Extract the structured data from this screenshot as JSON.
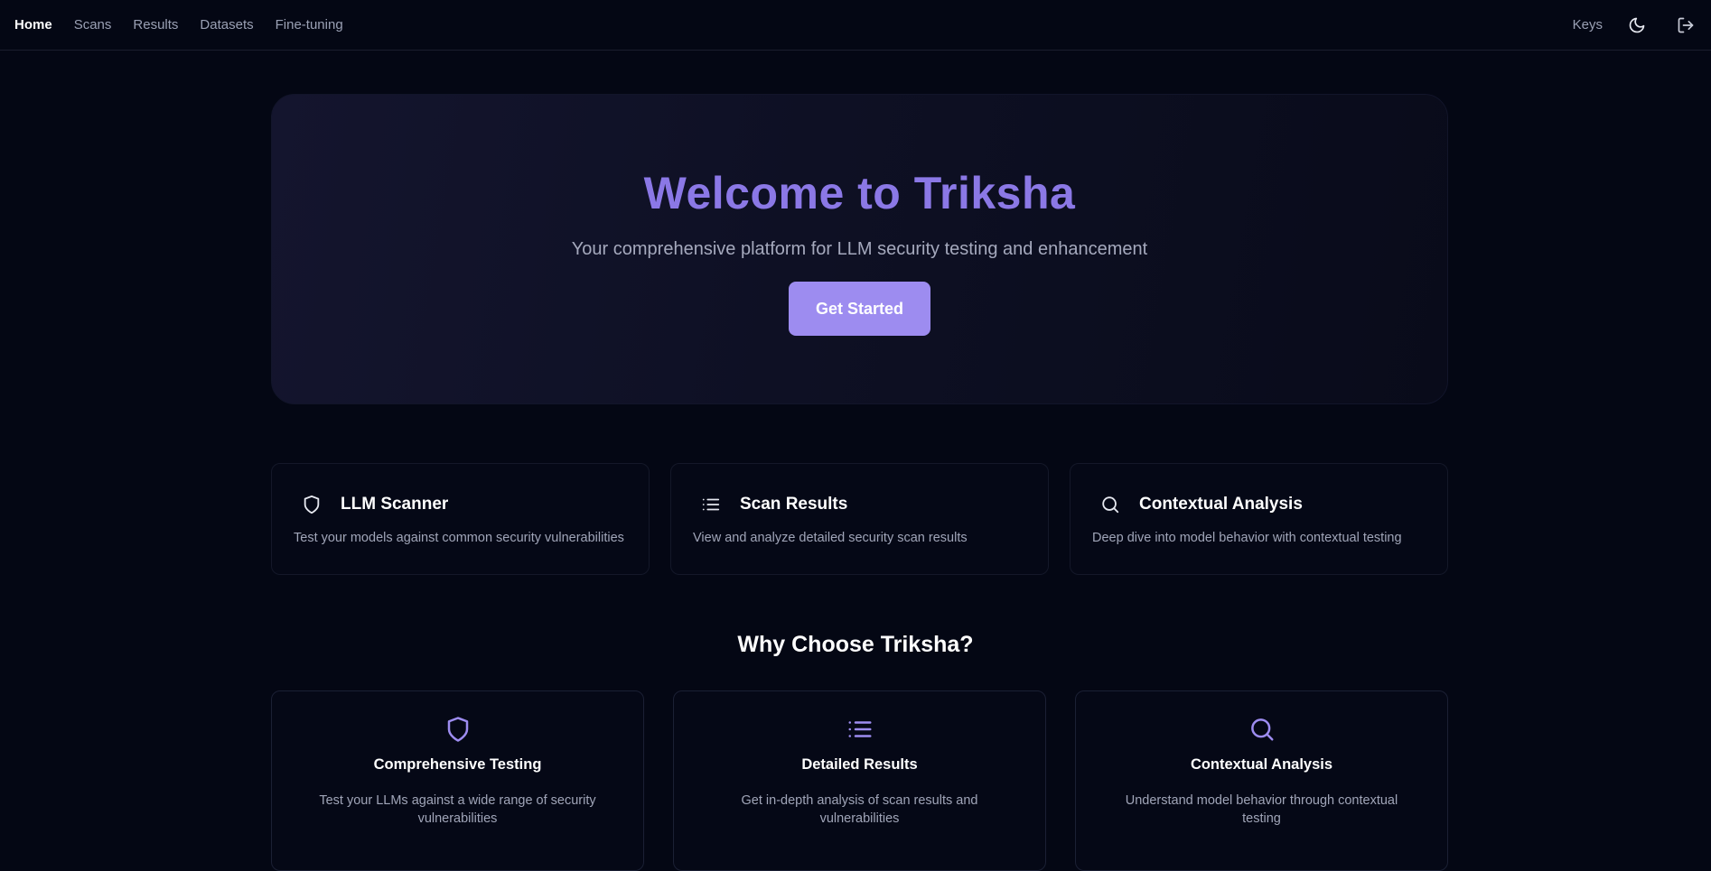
{
  "nav": {
    "items": [
      {
        "label": "Home",
        "active": true
      },
      {
        "label": "Scans",
        "active": false
      },
      {
        "label": "Results",
        "active": false
      },
      {
        "label": "Datasets",
        "active": false
      },
      {
        "label": "Fine-tuning",
        "active": false
      }
    ],
    "keys_label": "Keys",
    "theme_icon": "moon-icon",
    "logout_icon": "logout-icon"
  },
  "hero": {
    "title": "Welcome to Triksha",
    "subtitle": "Your comprehensive platform for LLM security testing and enhancement",
    "cta_label": "Get Started"
  },
  "features": [
    {
      "icon": "shield-icon",
      "title": "LLM Scanner",
      "description": "Test your models against common security vulnerabilities"
    },
    {
      "icon": "list-icon",
      "title": "Scan Results",
      "description": "View and analyze detailed security scan results"
    },
    {
      "icon": "search-icon",
      "title": "Contextual Analysis",
      "description": "Deep dive into model behavior with contextual testing"
    }
  ],
  "why": {
    "title": "Why Choose Triksha?",
    "cards": [
      {
        "icon": "shield-icon",
        "title": "Comprehensive Testing",
        "description": "Test your LLMs against a wide range of security vulnerabilities"
      },
      {
        "icon": "list-icon",
        "title": "Detailed Results",
        "description": "Get in-depth analysis of scan results and vulnerabilities"
      },
      {
        "icon": "search-icon",
        "title": "Contextual Analysis",
        "description": "Understand model behavior through contextual testing"
      }
    ]
  },
  "colors": {
    "background": "#040714",
    "accent": "#8b78e6",
    "button": "#9d8cf0"
  }
}
